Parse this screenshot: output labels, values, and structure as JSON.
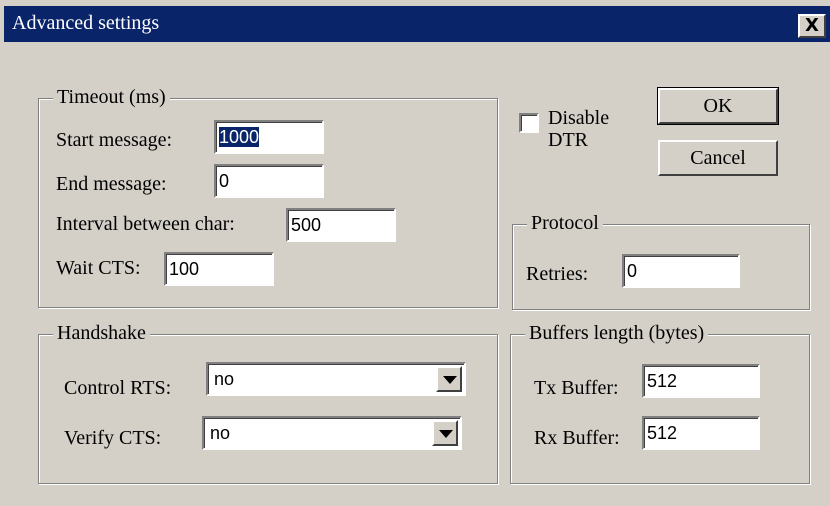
{
  "window": {
    "title": "Advanced settings",
    "close_label": "X"
  },
  "timeout": {
    "legend": "Timeout (ms)",
    "start_message_label": "Start message:",
    "start_message_value": "1000",
    "end_message_label": "End message:",
    "end_message_value": "0",
    "interval_label": "Interval between char:",
    "interval_value": "500",
    "wait_cts_label": "Wait CTS:",
    "wait_cts_value": "100"
  },
  "dtr": {
    "label_line1": "Disable",
    "label_line2": "DTR",
    "checked": false
  },
  "buttons": {
    "ok": "OK",
    "cancel": "Cancel"
  },
  "protocol": {
    "legend": "Protocol",
    "retries_label": "Retries:",
    "retries_value": "0"
  },
  "handshake": {
    "legend": "Handshake",
    "control_rts_label": "Control RTS:",
    "control_rts_value": "no",
    "verify_cts_label": "Verify CTS:",
    "verify_cts_value": "no"
  },
  "buffers": {
    "legend": "Buffers length (bytes)",
    "tx_label": "Tx Buffer:",
    "tx_value": "512",
    "rx_label": "Rx Buffer:",
    "rx_value": "512"
  }
}
